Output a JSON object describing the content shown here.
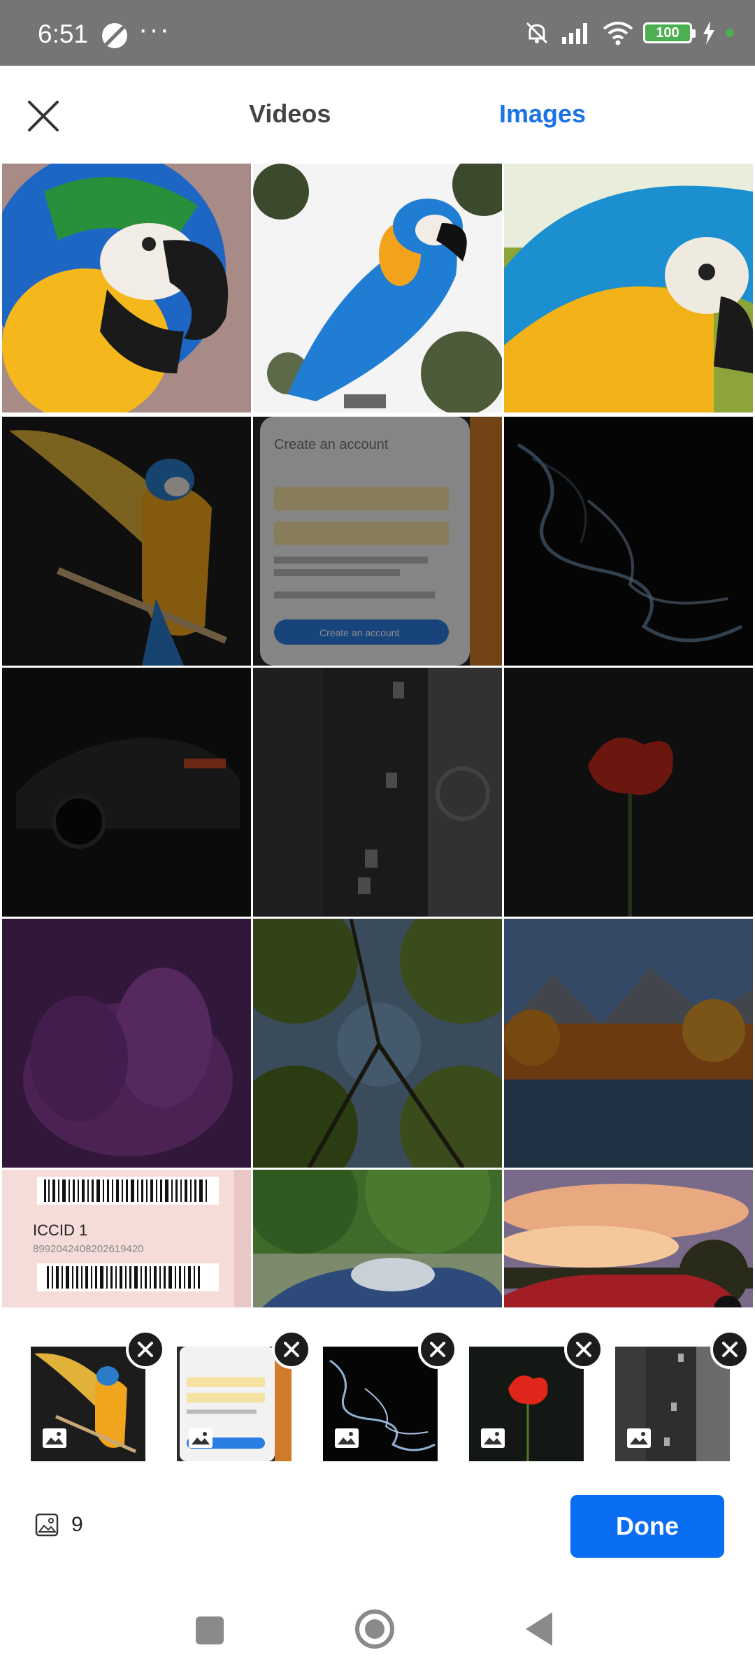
{
  "status_bar": {
    "time": "6:51",
    "more": "···",
    "battery": "100",
    "icons": [
      "mute-icon",
      "signal-icon",
      "wifi-icon",
      "battery-icon",
      "charging-icon"
    ]
  },
  "header": {
    "close_icon": "close-icon",
    "tab_videos": "Videos",
    "tab_images": "Images",
    "active_tab": "Images",
    "accent": "#1a73e8"
  },
  "grid": {
    "items": [
      {
        "subject": "macaw-closeup",
        "selected": false
      },
      {
        "subject": "macaw-perched",
        "selected": false
      },
      {
        "subject": "macaw-feathers",
        "selected": false
      },
      {
        "subject": "macaw-wings",
        "selected": true
      },
      {
        "subject": "phone-screen-create-account",
        "selected": true
      },
      {
        "subject": "smoke",
        "selected": true
      },
      {
        "subject": "dark-car",
        "selected": true
      },
      {
        "subject": "city-street-aerial",
        "selected": true
      },
      {
        "subject": "red-poppy",
        "selected": true
      },
      {
        "subject": "purple-flower",
        "selected": true
      },
      {
        "subject": "forest-canopy",
        "selected": true
      },
      {
        "subject": "autumn-lake",
        "selected": true
      },
      {
        "subject": "sim-card-barcode",
        "selected": false
      },
      {
        "subject": "blue-convertible",
        "selected": false
      },
      {
        "subject": "red-car-sunset",
        "selected": false
      }
    ],
    "phone_screen_text": {
      "title": "Create an account",
      "button": "Create an account"
    },
    "sim_text": {
      "label": "ICCID 1",
      "number": "8992042408202619420"
    }
  },
  "selected_strip": {
    "items": [
      {
        "subject": "macaw-wings"
      },
      {
        "subject": "phone-screen-create-account"
      },
      {
        "subject": "smoke"
      },
      {
        "subject": "red-poppy"
      },
      {
        "subject": "city-street-aerial"
      }
    ]
  },
  "footer": {
    "count": "9",
    "done_label": "Done",
    "done_color": "#0a6ef2"
  },
  "navbar": {
    "icons": [
      "recents-icon",
      "home-icon",
      "back-icon"
    ]
  }
}
